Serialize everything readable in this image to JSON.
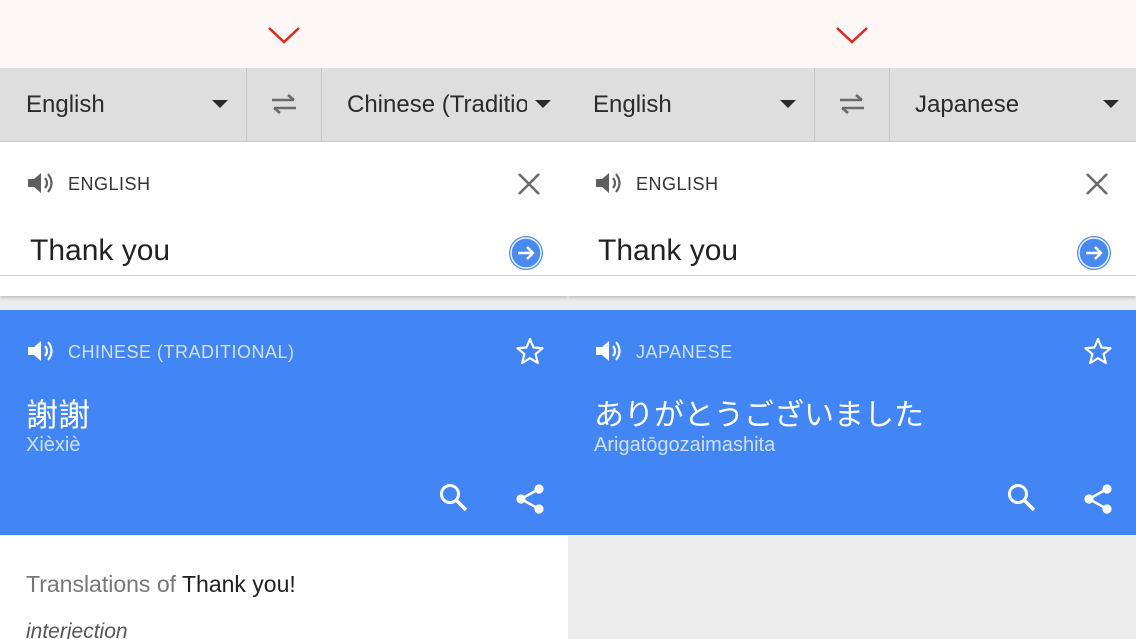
{
  "left": {
    "source_lang": "English",
    "target_lang": "Chinese (Traditional)",
    "input_label": "ENGLISH",
    "input_text": "Thank you",
    "result_label": "CHINESE (TRADITIONAL)",
    "result_text": "謝謝",
    "transliteration": "Xièxiè",
    "translations": {
      "prefix": "Translations of",
      "phrase": "Thank you!",
      "part_of_speech": "interjection"
    }
  },
  "right": {
    "source_lang": "English",
    "target_lang": "Japanese",
    "input_label": "ENGLISH",
    "input_text": "Thank you",
    "result_label": "JAPANESE",
    "result_text": "ありがとうございました",
    "transliteration": "Arigatōgozaimashita"
  },
  "icons": {
    "indicator": "chevron-down-icon",
    "swap": "swap-languages-icon",
    "dropdown": "dropdown-arrow-icon",
    "speaker": "speaker-icon",
    "clear": "close-icon",
    "go": "arrow-forward-icon",
    "star": "star-outline-icon",
    "search": "search-icon",
    "share": "share-icon"
  },
  "colors": {
    "accent_blue": "#4285f4",
    "indicator_red": "#e0271a",
    "lang_bar": "#dedede",
    "result_label": "#cfe0ff"
  }
}
